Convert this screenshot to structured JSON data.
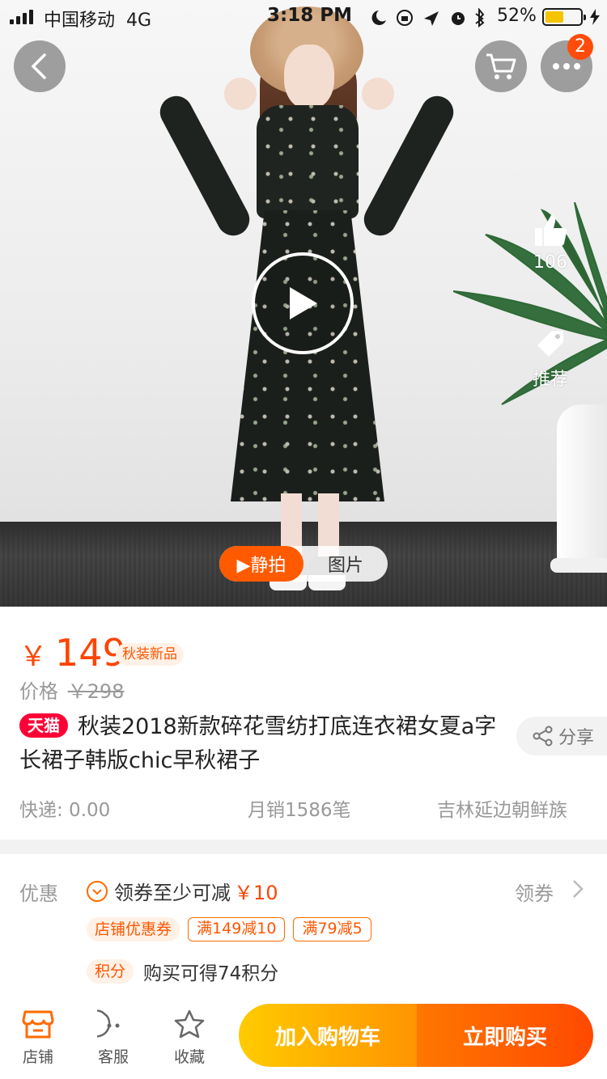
{
  "status_bar": {
    "carrier": "中国移动",
    "network": "4G",
    "time": "3:18 PM",
    "battery_percent": "52%",
    "battery_level": 0.52,
    "icons": [
      "moon-icon",
      "orientation-lock-icon",
      "location-icon",
      "alarm-icon",
      "bluetooth-icon",
      "charging-icon"
    ]
  },
  "top_actions": {
    "cart_badge": "2"
  },
  "side_actions": {
    "like_count": "106",
    "recommend_label": "推荐"
  },
  "media_tabs": {
    "static_label": "▶静拍",
    "photo_label": "图片"
  },
  "product": {
    "currency": "￥",
    "price": "149",
    "tag": "秋装新品",
    "orig_label": "价格",
    "orig_price": "￥298",
    "platform_badge": "天猫",
    "title": "秋装2018新款碎花雪纺打底连衣裙女夏a字长裙子韩版chic早秋裙子",
    "share_label": "分享",
    "delivery": "快递: 0.00",
    "monthly_sales": "月销1586笔",
    "location": "吉林延边朝鲜族"
  },
  "promo": {
    "label": "优惠",
    "coupon_text": "领券至少可减",
    "coupon_amount": "￥10",
    "get_coupon": "领券",
    "shop_coupon_chip": "店铺优惠券",
    "coupons": [
      "满149减10",
      "满79减5"
    ],
    "points_chip": "积分",
    "points_text": "购买可得74积分"
  },
  "bottom_bar": {
    "store": "店铺",
    "service": "客服",
    "favorite": "收藏",
    "add_to_cart": "加入购物车",
    "buy_now": "立即购买"
  },
  "colors": {
    "accent": "#ff4400",
    "cart_button": "#ffa000",
    "buy_button": "#ff5a00",
    "tmall_red": "#ff0036"
  }
}
